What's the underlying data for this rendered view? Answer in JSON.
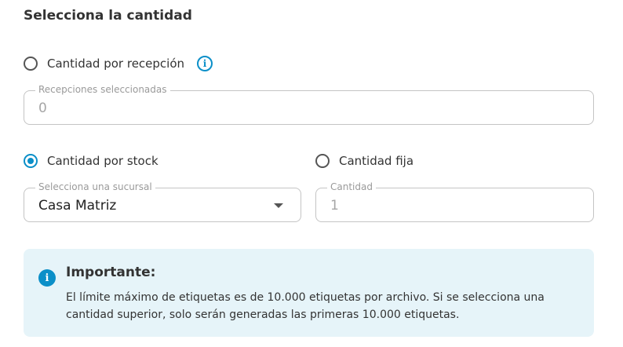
{
  "section": {
    "title": "Selecciona la cantidad"
  },
  "options": {
    "by_reception": {
      "label": "Cantidad por recepción",
      "selected": false,
      "info_icon": "info-circle-icon"
    },
    "by_stock": {
      "label": "Cantidad por stock",
      "selected": true
    },
    "fixed": {
      "label": "Cantidad fija",
      "selected": false
    }
  },
  "fields": {
    "receptions": {
      "label": "Recepciones seleccionadas",
      "value": "0"
    },
    "branch": {
      "label": "Selecciona una sucursal",
      "value": "Casa Matriz"
    },
    "quantity": {
      "label": "Cantidad",
      "value": "1"
    }
  },
  "notice": {
    "icon": "info-filled-icon",
    "title": "Importante:",
    "body": "El límite máximo de etiquetas es de 10.000 etiquetas por archivo. Si se selecciona una cantidad superior, solo serán generadas las primeras 10.000 etiquetas."
  },
  "colors": {
    "accent": "#0b8fc8",
    "notice_bg": "#e6f4f9"
  }
}
